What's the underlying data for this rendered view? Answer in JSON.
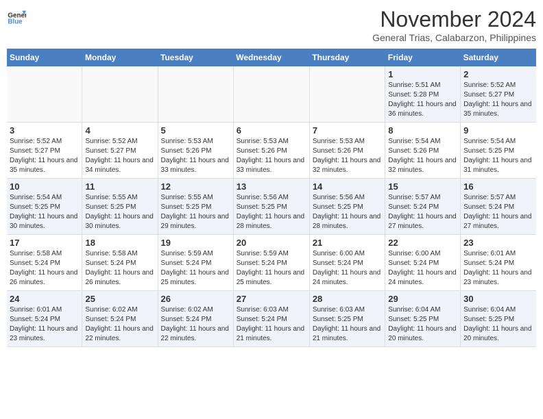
{
  "header": {
    "logo_line1": "General",
    "logo_line2": "Blue",
    "month": "November 2024",
    "location": "General Trias, Calabarzon, Philippines"
  },
  "weekdays": [
    "Sunday",
    "Monday",
    "Tuesday",
    "Wednesday",
    "Thursday",
    "Friday",
    "Saturday"
  ],
  "weeks": [
    [
      {
        "day": "",
        "info": ""
      },
      {
        "day": "",
        "info": ""
      },
      {
        "day": "",
        "info": ""
      },
      {
        "day": "",
        "info": ""
      },
      {
        "day": "",
        "info": ""
      },
      {
        "day": "1",
        "info": "Sunrise: 5:51 AM\nSunset: 5:28 PM\nDaylight: 11 hours and 36 minutes."
      },
      {
        "day": "2",
        "info": "Sunrise: 5:52 AM\nSunset: 5:27 PM\nDaylight: 11 hours and 35 minutes."
      }
    ],
    [
      {
        "day": "3",
        "info": "Sunrise: 5:52 AM\nSunset: 5:27 PM\nDaylight: 11 hours and 35 minutes."
      },
      {
        "day": "4",
        "info": "Sunrise: 5:52 AM\nSunset: 5:27 PM\nDaylight: 11 hours and 34 minutes."
      },
      {
        "day": "5",
        "info": "Sunrise: 5:53 AM\nSunset: 5:26 PM\nDaylight: 11 hours and 33 minutes."
      },
      {
        "day": "6",
        "info": "Sunrise: 5:53 AM\nSunset: 5:26 PM\nDaylight: 11 hours and 33 minutes."
      },
      {
        "day": "7",
        "info": "Sunrise: 5:53 AM\nSunset: 5:26 PM\nDaylight: 11 hours and 32 minutes."
      },
      {
        "day": "8",
        "info": "Sunrise: 5:54 AM\nSunset: 5:26 PM\nDaylight: 11 hours and 32 minutes."
      },
      {
        "day": "9",
        "info": "Sunrise: 5:54 AM\nSunset: 5:25 PM\nDaylight: 11 hours and 31 minutes."
      }
    ],
    [
      {
        "day": "10",
        "info": "Sunrise: 5:54 AM\nSunset: 5:25 PM\nDaylight: 11 hours and 30 minutes."
      },
      {
        "day": "11",
        "info": "Sunrise: 5:55 AM\nSunset: 5:25 PM\nDaylight: 11 hours and 30 minutes."
      },
      {
        "day": "12",
        "info": "Sunrise: 5:55 AM\nSunset: 5:25 PM\nDaylight: 11 hours and 29 minutes."
      },
      {
        "day": "13",
        "info": "Sunrise: 5:56 AM\nSunset: 5:25 PM\nDaylight: 11 hours and 28 minutes."
      },
      {
        "day": "14",
        "info": "Sunrise: 5:56 AM\nSunset: 5:25 PM\nDaylight: 11 hours and 28 minutes."
      },
      {
        "day": "15",
        "info": "Sunrise: 5:57 AM\nSunset: 5:24 PM\nDaylight: 11 hours and 27 minutes."
      },
      {
        "day": "16",
        "info": "Sunrise: 5:57 AM\nSunset: 5:24 PM\nDaylight: 11 hours and 27 minutes."
      }
    ],
    [
      {
        "day": "17",
        "info": "Sunrise: 5:58 AM\nSunset: 5:24 PM\nDaylight: 11 hours and 26 minutes."
      },
      {
        "day": "18",
        "info": "Sunrise: 5:58 AM\nSunset: 5:24 PM\nDaylight: 11 hours and 26 minutes."
      },
      {
        "day": "19",
        "info": "Sunrise: 5:59 AM\nSunset: 5:24 PM\nDaylight: 11 hours and 25 minutes."
      },
      {
        "day": "20",
        "info": "Sunrise: 5:59 AM\nSunset: 5:24 PM\nDaylight: 11 hours and 25 minutes."
      },
      {
        "day": "21",
        "info": "Sunrise: 6:00 AM\nSunset: 5:24 PM\nDaylight: 11 hours and 24 minutes."
      },
      {
        "day": "22",
        "info": "Sunrise: 6:00 AM\nSunset: 5:24 PM\nDaylight: 11 hours and 24 minutes."
      },
      {
        "day": "23",
        "info": "Sunrise: 6:01 AM\nSunset: 5:24 PM\nDaylight: 11 hours and 23 minutes."
      }
    ],
    [
      {
        "day": "24",
        "info": "Sunrise: 6:01 AM\nSunset: 5:24 PM\nDaylight: 11 hours and 23 minutes."
      },
      {
        "day": "25",
        "info": "Sunrise: 6:02 AM\nSunset: 5:24 PM\nDaylight: 11 hours and 22 minutes."
      },
      {
        "day": "26",
        "info": "Sunrise: 6:02 AM\nSunset: 5:24 PM\nDaylight: 11 hours and 22 minutes."
      },
      {
        "day": "27",
        "info": "Sunrise: 6:03 AM\nSunset: 5:24 PM\nDaylight: 11 hours and 21 minutes."
      },
      {
        "day": "28",
        "info": "Sunrise: 6:03 AM\nSunset: 5:25 PM\nDaylight: 11 hours and 21 minutes."
      },
      {
        "day": "29",
        "info": "Sunrise: 6:04 AM\nSunset: 5:25 PM\nDaylight: 11 hours and 20 minutes."
      },
      {
        "day": "30",
        "info": "Sunrise: 6:04 AM\nSunset: 5:25 PM\nDaylight: 11 hours and 20 minutes."
      }
    ]
  ]
}
